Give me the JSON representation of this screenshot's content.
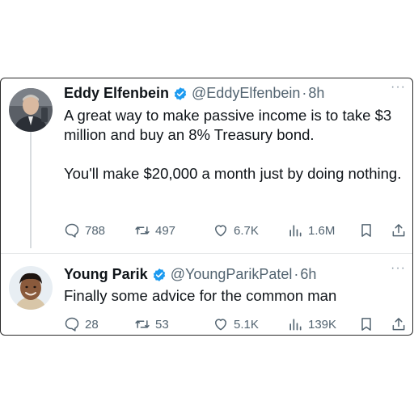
{
  "tweets": [
    {
      "name": "Eddy Elfenbein",
      "handle": "@EddyElfenbein",
      "separator": "·",
      "time": "8h",
      "text_line1": "A great way to make passive income is to take $3 million and buy an 8% Treasury bond.",
      "text_line2": "You'll make $20,000 a month just by doing nothing.",
      "more": "···",
      "replies": "788",
      "retweets": "497",
      "likes": "6.7K",
      "views": "1.6M"
    },
    {
      "name": "Young Parik",
      "handle": "@YoungParikPatel",
      "separator": "·",
      "time": "6h",
      "text": "Finally some advice for the common man",
      "more": "···",
      "replies": "28",
      "retweets": "53",
      "likes": "5.1K",
      "views": "139K"
    }
  ],
  "icons": {
    "reply": "reply-icon",
    "retweet": "retweet-icon",
    "like": "heart-icon",
    "views": "views-icon",
    "bookmark": "bookmark-icon",
    "share": "share-icon",
    "verified": "verified-badge-icon"
  },
  "colors": {
    "verified": "#1d9bf0",
    "text": "#0f1419",
    "secondary": "#536471"
  }
}
